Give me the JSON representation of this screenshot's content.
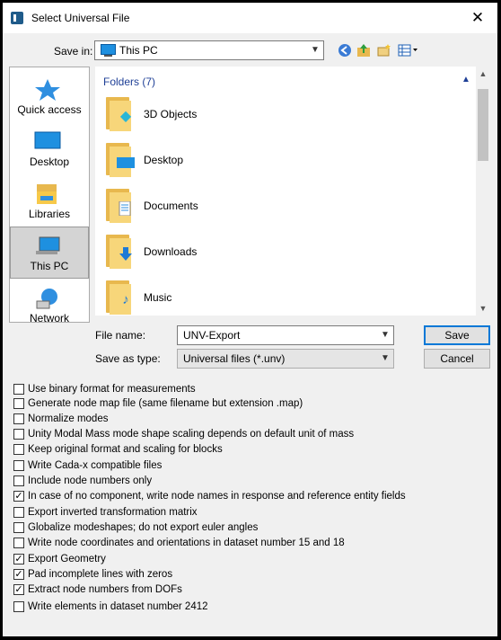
{
  "window": {
    "title": "Select Universal File",
    "close_glyph": "✕"
  },
  "savein": {
    "label": "Save in:",
    "value": "This PC"
  },
  "places": [
    {
      "label": "Quick access",
      "icon": "star-icon"
    },
    {
      "label": "Desktop",
      "icon": "desktop-icon"
    },
    {
      "label": "Libraries",
      "icon": "libraries-icon"
    },
    {
      "label": "This PC",
      "icon": "computer-icon",
      "selected": true
    },
    {
      "label": "Network",
      "icon": "network-icon"
    }
  ],
  "filelist": {
    "group_header": "Folders (7)",
    "folders": [
      {
        "name": "3D Objects",
        "icon": "3d-objects-icon"
      },
      {
        "name": "Desktop",
        "icon": "desktop-folder-icon"
      },
      {
        "name": "Documents",
        "icon": "documents-folder-icon"
      },
      {
        "name": "Downloads",
        "icon": "downloads-folder-icon"
      },
      {
        "name": "Music",
        "icon": "music-folder-icon"
      }
    ]
  },
  "filename": {
    "label": "File name:",
    "value": "UNV-Export"
  },
  "filetype": {
    "label": "Save as type:",
    "value": "Universal files (*.unv)"
  },
  "buttons": {
    "save": "Save",
    "cancel": "Cancel"
  },
  "options": [
    {
      "label": "Use binary format for measurements",
      "checked": false
    },
    {
      "label": "Generate node map file (same filename but extension .map)",
      "checked": false
    },
    {
      "label": "Normalize modes",
      "checked": false
    },
    {
      "label": "Unity Modal Mass mode shape scaling depends on default unit of mass",
      "checked": false
    },
    {
      "label": "Keep original format and scaling for blocks",
      "checked": false
    },
    {
      "label": "Write Cada-x compatible files",
      "checked": false
    },
    {
      "label": "Include node numbers only",
      "checked": false
    },
    {
      "label": "In case of no component, write node names in response and reference entity fields",
      "checked": true
    },
    {
      "label": "Export inverted transformation matrix",
      "checked": false
    },
    {
      "label": "Globalize modeshapes; do not export euler angles",
      "checked": false
    },
    {
      "label": "Write node coordinates and orientations in dataset number 15 and 18",
      "checked": false
    },
    {
      "label": "Export Geometry",
      "checked": true
    },
    {
      "label": "Pad incomplete lines with zeros",
      "checked": true
    },
    {
      "label": "Extract node numbers from DOFs",
      "checked": true
    },
    {
      "label": "Write elements in dataset number 2412",
      "checked": false
    }
  ]
}
